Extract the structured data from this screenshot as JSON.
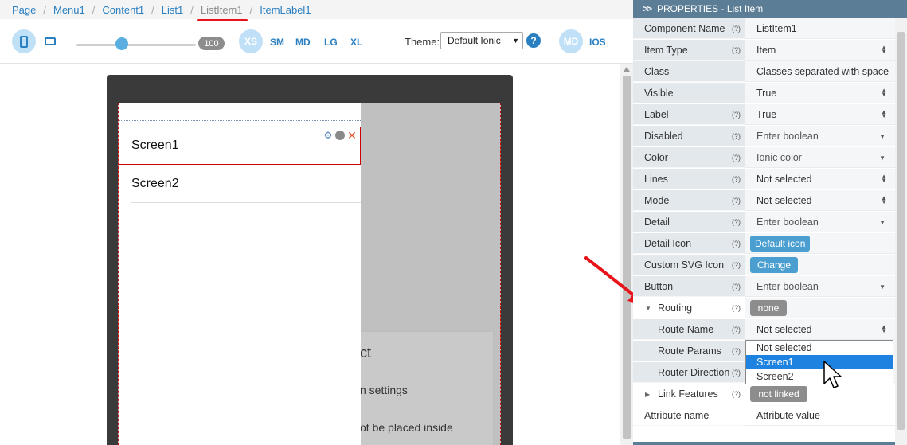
{
  "breadcrumb": {
    "items": [
      "Page",
      "Menu1",
      "Content1",
      "List1",
      "ListItem1",
      "ItemLabel1"
    ],
    "separator": "/"
  },
  "toolbar": {
    "zoom": "100",
    "breakpoints": [
      "XS",
      "SM",
      "MD",
      "LG",
      "XL"
    ],
    "theme_label": "Theme:",
    "theme_value": "Default Ionic",
    "help": "?",
    "modes": [
      "MD",
      "IOS"
    ]
  },
  "canvas": {
    "list_items": [
      "Screen1",
      "Screen2"
    ],
    "background_fragments": [
      "ct",
      "n settings",
      "ot be placed inside"
    ]
  },
  "panel": {
    "title": "PROPERTIES - List Item",
    "chevrons": ">>",
    "help_marker": "(?)",
    "rows": [
      {
        "name": "Component Name",
        "value": "ListItem1"
      },
      {
        "name": "Item Type",
        "value": "Item"
      },
      {
        "name": "Class",
        "value": "Classes separated with space"
      },
      {
        "name": "Visible",
        "value": "True"
      },
      {
        "name": "Label",
        "value": "True"
      },
      {
        "name": "Disabled",
        "value": "Enter boolean"
      },
      {
        "name": "Color",
        "value": "Ionic color"
      },
      {
        "name": "Lines",
        "value": "Not selected"
      },
      {
        "name": "Mode",
        "value": "Not selected"
      },
      {
        "name": "Detail",
        "value": "Enter boolean"
      },
      {
        "name": "Detail Icon",
        "value": "Default icon"
      },
      {
        "name": "Custom SVG Icon",
        "value": "Change"
      },
      {
        "name": "Button",
        "value": "Enter boolean"
      },
      {
        "name": "Routing",
        "value": "none"
      },
      {
        "name": "Route Name",
        "value": "Not selected"
      },
      {
        "name": "Route Params",
        "value": ""
      },
      {
        "name": "Router Direction",
        "value": ""
      },
      {
        "name": "Link Features",
        "value": "not linked"
      },
      {
        "name": "Attribute name",
        "value": "Attribute value"
      }
    ]
  },
  "route_dropdown": {
    "options": [
      "Not selected",
      "Screen1",
      "Screen2"
    ],
    "highlighted": "Screen1"
  },
  "colors": {
    "accent": "#2a7fc0",
    "panel_header": "#5c7d96",
    "highlight": "#1e82e0",
    "annotation_red": "#e8141a"
  }
}
